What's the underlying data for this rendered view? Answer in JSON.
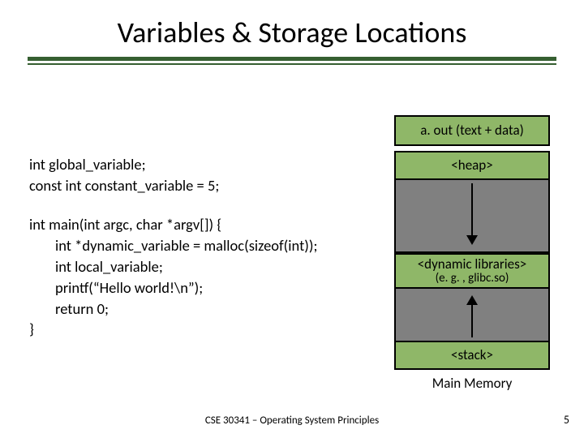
{
  "title": "Variables & Storage Locations",
  "code1_l1": "int global_variable;",
  "code1_l2": "const int constant_variable = 5;",
  "code2_l1": "int main(int argc, char *argv[]) {",
  "code2_l2": "int *dynamic_variable = malloc(sizeof(int));",
  "code2_l3": "int local_variable;",
  "code2_l4": "printf(“Hello world!\\n”);",
  "code2_l5": "return 0;",
  "code2_l6": "}",
  "mem_aout": "a. out (text + data)",
  "mem_heap": "<heap>",
  "mem_dyn_l1": "<dynamic libraries>",
  "mem_dyn_l2": "(e. g. , glibc.so)",
  "mem_stack": "<stack>",
  "mem_caption": "Main Memory",
  "footer": "CSE 30341 – Operating System Principles",
  "pagen": "5"
}
